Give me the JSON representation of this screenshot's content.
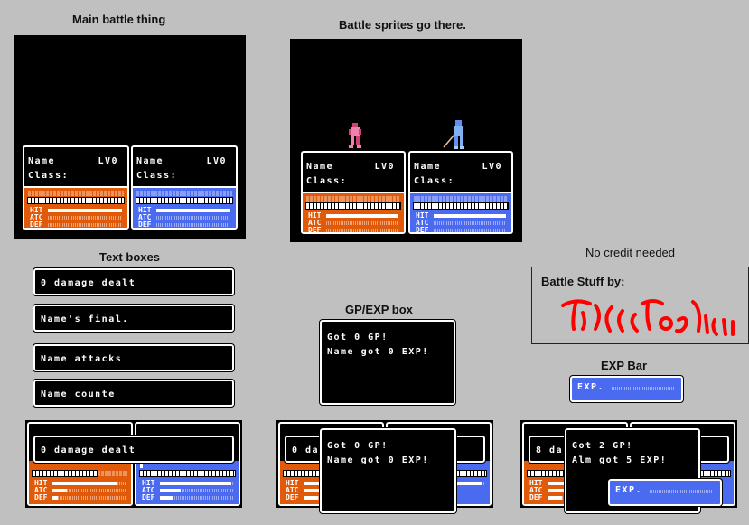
{
  "sections": {
    "main_battle": "Main battle thing",
    "sprites": "Battle sprites go there.",
    "text_boxes": "Text boxes",
    "gp_exp": "GP/EXP box",
    "no_credit": "No credit needed",
    "exp_bar": "EXP Bar"
  },
  "panel": {
    "name": "Name",
    "level": "LV0",
    "class": "Class:",
    "stats": [
      "HIT",
      "ATC",
      "DEF"
    ]
  },
  "colors": {
    "player_panel": "#e05a0a",
    "enemy_panel": "#4a6af0",
    "background": "#c0c0c0",
    "signature": "#ff0000"
  },
  "text_boxes": [
    "0 damage dealt",
    "Name's final.",
    "Name attacks",
    "Name counte"
  ],
  "gp_box": {
    "line1": "Got 0 GP!",
    "line2": "Name got 0 EXP!"
  },
  "credit": {
    "label": "Battle Stuff by:",
    "signature": "TiKiCiTooMu"
  },
  "exp_label": "EXP.",
  "examples": {
    "damage_text": "0 damage dealt",
    "damage_text_short": "0 da",
    "damage_text_final": "8 da",
    "final_gp": "Got 2 GP!",
    "final_exp": "Alm got 5 EXP!",
    "left_hp_fraction": 0.7,
    "left_hit": 0.9,
    "left_atc": 0.2,
    "left_def": 0.08,
    "right_hp_fraction": 0.02,
    "right_hit": 0.98,
    "right_atc": 0.3,
    "right_def": 0.2
  }
}
